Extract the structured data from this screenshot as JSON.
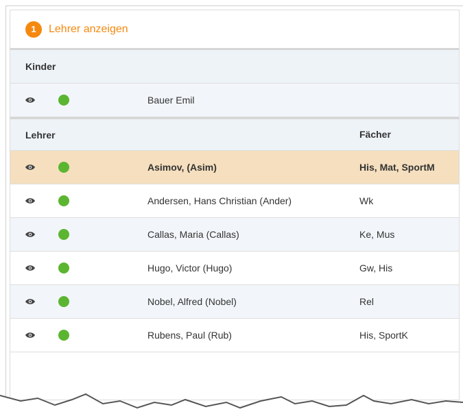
{
  "header": {
    "step": "1",
    "title": "Lehrer anzeigen"
  },
  "kinder": {
    "label": "Kinder",
    "rows": [
      {
        "name": "Bauer Emil"
      }
    ]
  },
  "lehrer": {
    "label": "Lehrer",
    "subjects_label": "Fächer",
    "rows": [
      {
        "name": "Asimov, (Asim)",
        "subjects": "His, Mat, SportM",
        "selected": true
      },
      {
        "name": "Andersen, Hans Christian (Ander)",
        "subjects": "Wk"
      },
      {
        "name": "Callas, Maria (Callas)",
        "subjects": "Ke, Mus"
      },
      {
        "name": "Hugo, Victor (Hugo)",
        "subjects": "Gw, His"
      },
      {
        "name": "Nobel, Alfred (Nobel)",
        "subjects": "Rel"
      },
      {
        "name": "Rubens, Paul (Rub)",
        "subjects": "His, SportK"
      }
    ]
  },
  "colors": {
    "accent": "#f5890f",
    "status_online": "#5cb531",
    "selected_row": "#f5dfbe",
    "alt_row": "#f2f6fa"
  },
  "icons": {
    "view": "eye-icon",
    "status": "status-dot-icon"
  }
}
